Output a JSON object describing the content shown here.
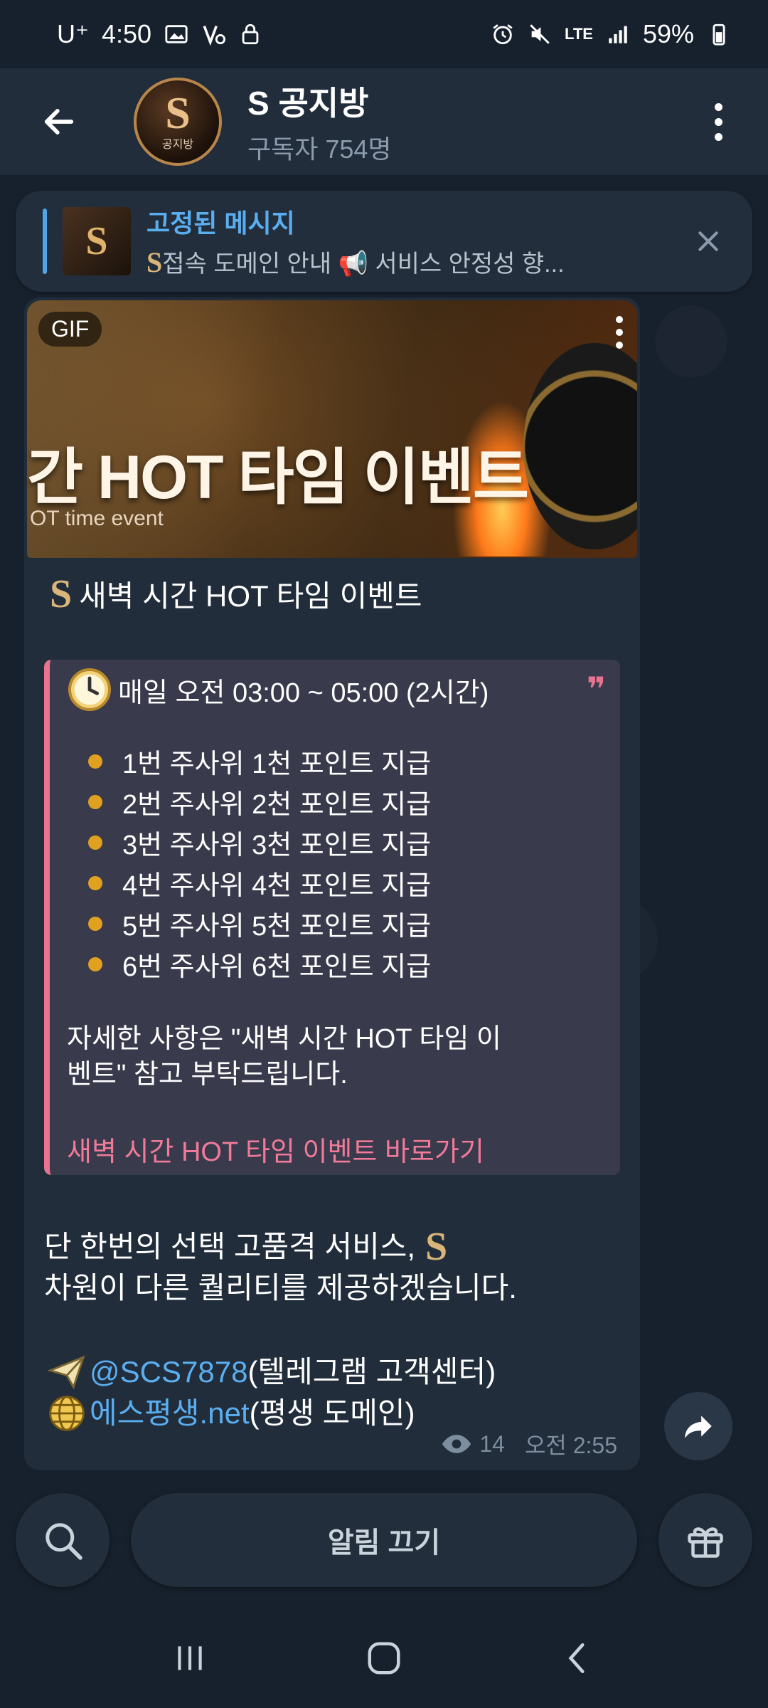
{
  "status_bar": {
    "carrier": "U⁺",
    "time": "4:50",
    "network": "LTE",
    "battery": "59%"
  },
  "header": {
    "avatar_label": "공지방",
    "title": "S 공지방",
    "subtitle": "구독자 754명"
  },
  "pinned": {
    "title": "고정된 메시지",
    "preview": "접속 도메인 안내  📢 서비스 안정성 향..."
  },
  "message": {
    "gif_badge": "GIF",
    "gif_headline": "간 HOT 타임 이벤트",
    "gif_subline": "OT time event",
    "title": "새벽 시간 HOT 타임 이벤트",
    "quote": {
      "time": "매일 오전 03:00 ~ 05:00 (2시간)",
      "items": [
        "1번 주사위 1천 포인트 지급",
        "2번 주사위 2천 포인트 지급",
        "3번 주사위 3천 포인트 지급",
        "4번 주사위 4천 포인트 지급",
        "5번 주사위 5천 포인트 지급",
        "6번 주사위 6천 포인트 지급"
      ],
      "note": "자세한 사항은 \"새벽 시간 HOT 타임 이벤트\" 참고 부탁드립니다.",
      "link": "새벽 시간 HOT 타임 이벤트 바로가기"
    },
    "body_line1": "단 한번의 선택 고품격 서비스,",
    "body_line2": "차원이 다른 퀄리티를 제공하겠습니다.",
    "contact_handle": "@SCS7878",
    "contact_handle_desc": " (텔레그램 고객센터)",
    "contact_domain": "에스평생.net",
    "contact_domain_desc": " (평생 도메인)",
    "views": "14",
    "time": "오전 2:55"
  },
  "bottom": {
    "mute_label": "알림 끄기"
  },
  "colors": {
    "background": "#17212d",
    "bubble": "#212d3b",
    "accent_link": "#5aaef0",
    "quote_border": "#e8738f"
  }
}
